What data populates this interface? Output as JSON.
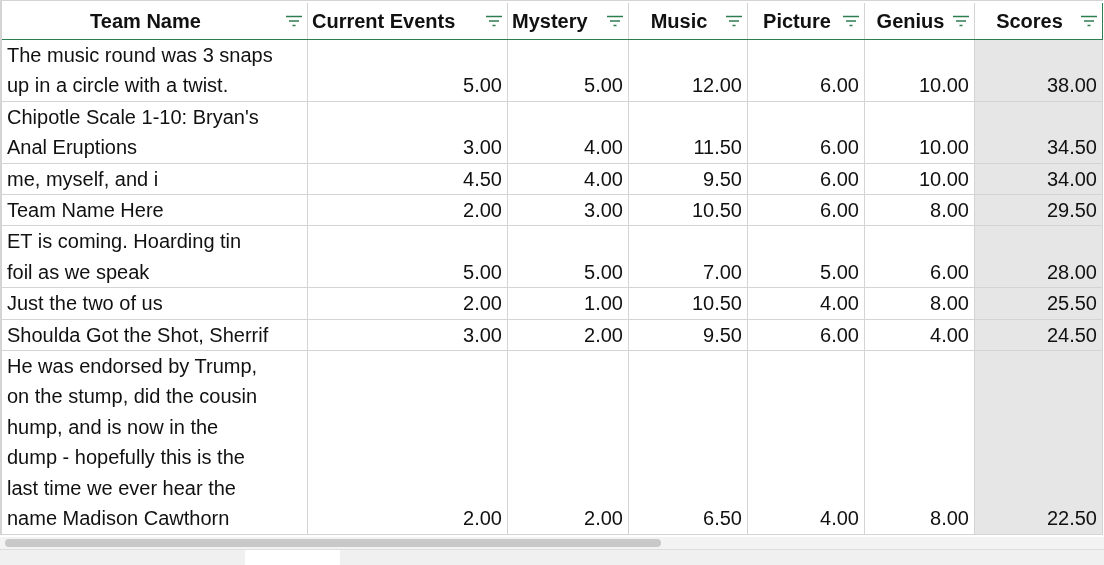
{
  "table": {
    "columns": [
      {
        "label": "Team Name",
        "selected": false
      },
      {
        "label": "Current Events",
        "selected": false
      },
      {
        "label": "Mystery",
        "selected": false
      },
      {
        "label": "Music",
        "selected": false
      },
      {
        "label": "Picture",
        "selected": false
      },
      {
        "label": "Genius",
        "selected": false
      },
      {
        "label": "Scores",
        "selected": true
      }
    ],
    "rows": [
      {
        "cells": [
          "The music round was 3 snaps\nup in a circle with a twist.",
          "5.00",
          "5.00",
          "12.00",
          "6.00",
          "10.00",
          "38.00"
        ]
      },
      {
        "cells": [
          "Chipotle Scale 1-10: Bryan's\nAnal Eruptions",
          "3.00",
          "4.00",
          "11.50",
          "6.00",
          "10.00",
          "34.50"
        ]
      },
      {
        "cells": [
          "me, myself, and i",
          "4.50",
          "4.00",
          "9.50",
          "6.00",
          "10.00",
          "34.00"
        ]
      },
      {
        "cells": [
          "Team Name Here",
          "2.00",
          "3.00",
          "10.50",
          "6.00",
          "8.00",
          "29.50"
        ]
      },
      {
        "cells": [
          "ET is coming. Hoarding tin\nfoil as we speak",
          "5.00",
          "5.00",
          "7.00",
          "5.00",
          "6.00",
          "28.00"
        ]
      },
      {
        "cells": [
          "Just the two of us",
          "2.00",
          "1.00",
          "10.50",
          "4.00",
          "8.00",
          "25.50"
        ]
      },
      {
        "cells": [
          "Shoulda Got the Shot, Sherrif",
          "3.00",
          "2.00",
          "9.50",
          "6.00",
          "4.00",
          "24.50"
        ]
      },
      {
        "cells": [
          "He was endorsed by Trump,\non the stump, did the cousin\nhump, and is now in the\ndump - hopefully this is the\nlast time we ever hear the\nname Madison Cawthorn",
          "2.00",
          "2.00",
          "6.50",
          "4.00",
          "8.00",
          "22.50"
        ]
      }
    ]
  }
}
